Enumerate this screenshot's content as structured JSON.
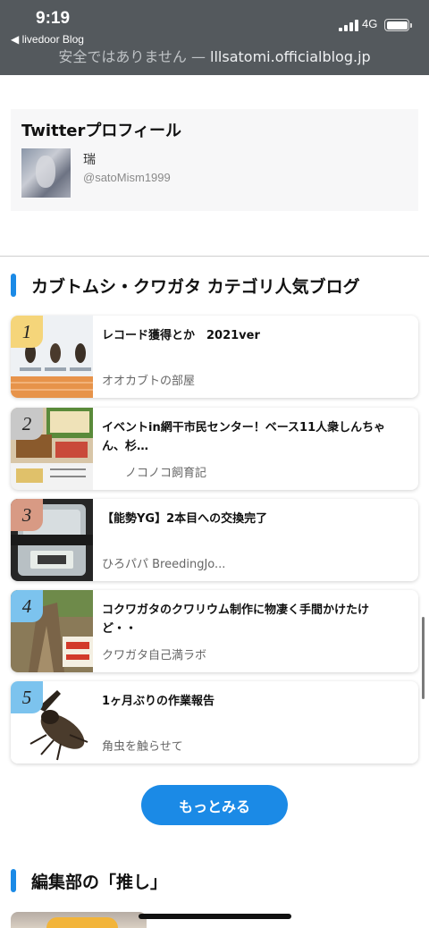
{
  "status_bar": {
    "time": "9:19",
    "back_app": "◀ livedoor Blog",
    "network": "4G"
  },
  "browser": {
    "security_text": "安全ではありません",
    "separator": " — ",
    "host": "lllsatomi.officialblog.jp"
  },
  "twitter_profile": {
    "title": "Twitterプロフィール",
    "name": "瑞",
    "handle": "@satoMism1999"
  },
  "ranking_section": {
    "title": "カブトムシ・クワガタ カテゴリ人気ブログ",
    "items": [
      {
        "rank": "1",
        "title": "レコード獲得とか　2021ver",
        "blog": "オオカブトの部屋",
        "badge_color": "#f5d57a"
      },
      {
        "rank": "2",
        "title": "イベントin網干市民センター！ベース11人衆しんちゃん、杉…",
        "blog": "　　ノコノコ飼育記",
        "badge_color": "#c8c8c8"
      },
      {
        "rank": "3",
        "title": "【能勢YG】2本目への交換完了",
        "blog": "ひろパパ BreedingJo...",
        "badge_color": "#d89a84"
      },
      {
        "rank": "4",
        "title": "コクワガタのクワリウム制作に物凄く手間かけたけど・・",
        "blog": "クワガタ自己満ラボ",
        "badge_color": "#7cc3ee"
      },
      {
        "rank": "5",
        "title": "1ヶ月ぶりの作業報告",
        "blog": "角虫を触らせて",
        "badge_color": "#7cc3ee"
      }
    ],
    "more_button": "もっとみる"
  },
  "editor_section": {
    "title": "編集部の「推し」"
  },
  "colors": {
    "accent": "#1b8ae6"
  }
}
